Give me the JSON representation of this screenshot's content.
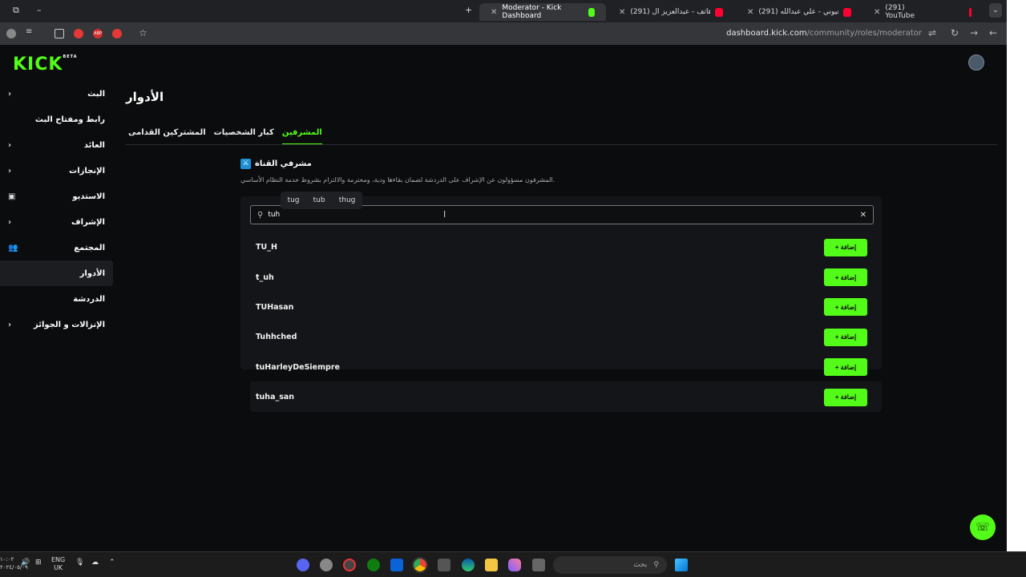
{
  "browser": {
    "tabs": [
      {
        "title": "Moderator - Kick Dashboard",
        "active": true,
        "favicon": "#53fc18"
      },
      {
        "title": "(291) لاخط لا هاتف - عبدالعزيز ال",
        "active": false,
        "favicon": "#ff0033"
      },
      {
        "title": "(291) عارت عيوني - علي عبدالله",
        "active": false,
        "favicon": "#ff0033"
      },
      {
        "title": "(291) YouTube",
        "active": false,
        "favicon": "#ff0033"
      }
    ],
    "new_tab": "+",
    "url_host": "dashboard.kick.com",
    "url_path": "/community/roles/moderator"
  },
  "app": {
    "logo": "KICK",
    "logo_badge": "BETA",
    "accent": "#53fc18"
  },
  "sidebar": {
    "items": [
      {
        "label": "البث",
        "icon": "chevron-icon",
        "glyph": "›"
      },
      {
        "label": "رابط ومفتاح البث",
        "icon": "",
        "glyph": ""
      },
      {
        "label": "العائد",
        "icon": "chevron-icon",
        "glyph": "›"
      },
      {
        "label": "الإنجازات",
        "icon": "chevron-icon",
        "glyph": "›"
      },
      {
        "label": "الاستديو",
        "icon": "studio-icon",
        "glyph": "▣"
      },
      {
        "label": "الإشراف",
        "icon": "chevron-icon",
        "glyph": "›"
      },
      {
        "label": "المجتمع",
        "icon": "community-icon",
        "glyph": "👥"
      },
      {
        "label": "الأدوار",
        "icon": "",
        "glyph": "",
        "active": true
      },
      {
        "label": "الدردشة",
        "icon": "",
        "glyph": ""
      },
      {
        "label": "الإنزالات و الجوائز",
        "icon": "chevron-icon",
        "glyph": "›"
      }
    ]
  },
  "main": {
    "title": "الأدوار",
    "tabs": [
      {
        "label": "المشرفين",
        "selected": true
      },
      {
        "label": "كبار الشخصيات",
        "selected": false
      },
      {
        "label": "المشتركين القدامى",
        "selected": false
      }
    ],
    "section_title": "مشرفي القناة",
    "section_desc": "المشرفون مسؤولون عن الإشراف على الدردشة لضمان بقاءها ودية، ومحترمة والالتزام بشروط خدمة النظام الأساسي.",
    "search": {
      "value": "tuh",
      "suggestions": [
        "tug",
        "tub",
        "thug"
      ]
    },
    "add_label": "+ إضافة",
    "results": [
      "TU_H",
      "t_uh",
      "TUHasan",
      "Tuhhched",
      "tuHarleyDeSiempre",
      "tuha_san"
    ]
  },
  "taskbar": {
    "search_placeholder": "بحث",
    "lang_top": "ENG",
    "lang_bottom": "UK",
    "clock_top": "١٠:٠٢",
    "clock_bottom": "٢٠٢٤/٠٥/٠٩"
  }
}
